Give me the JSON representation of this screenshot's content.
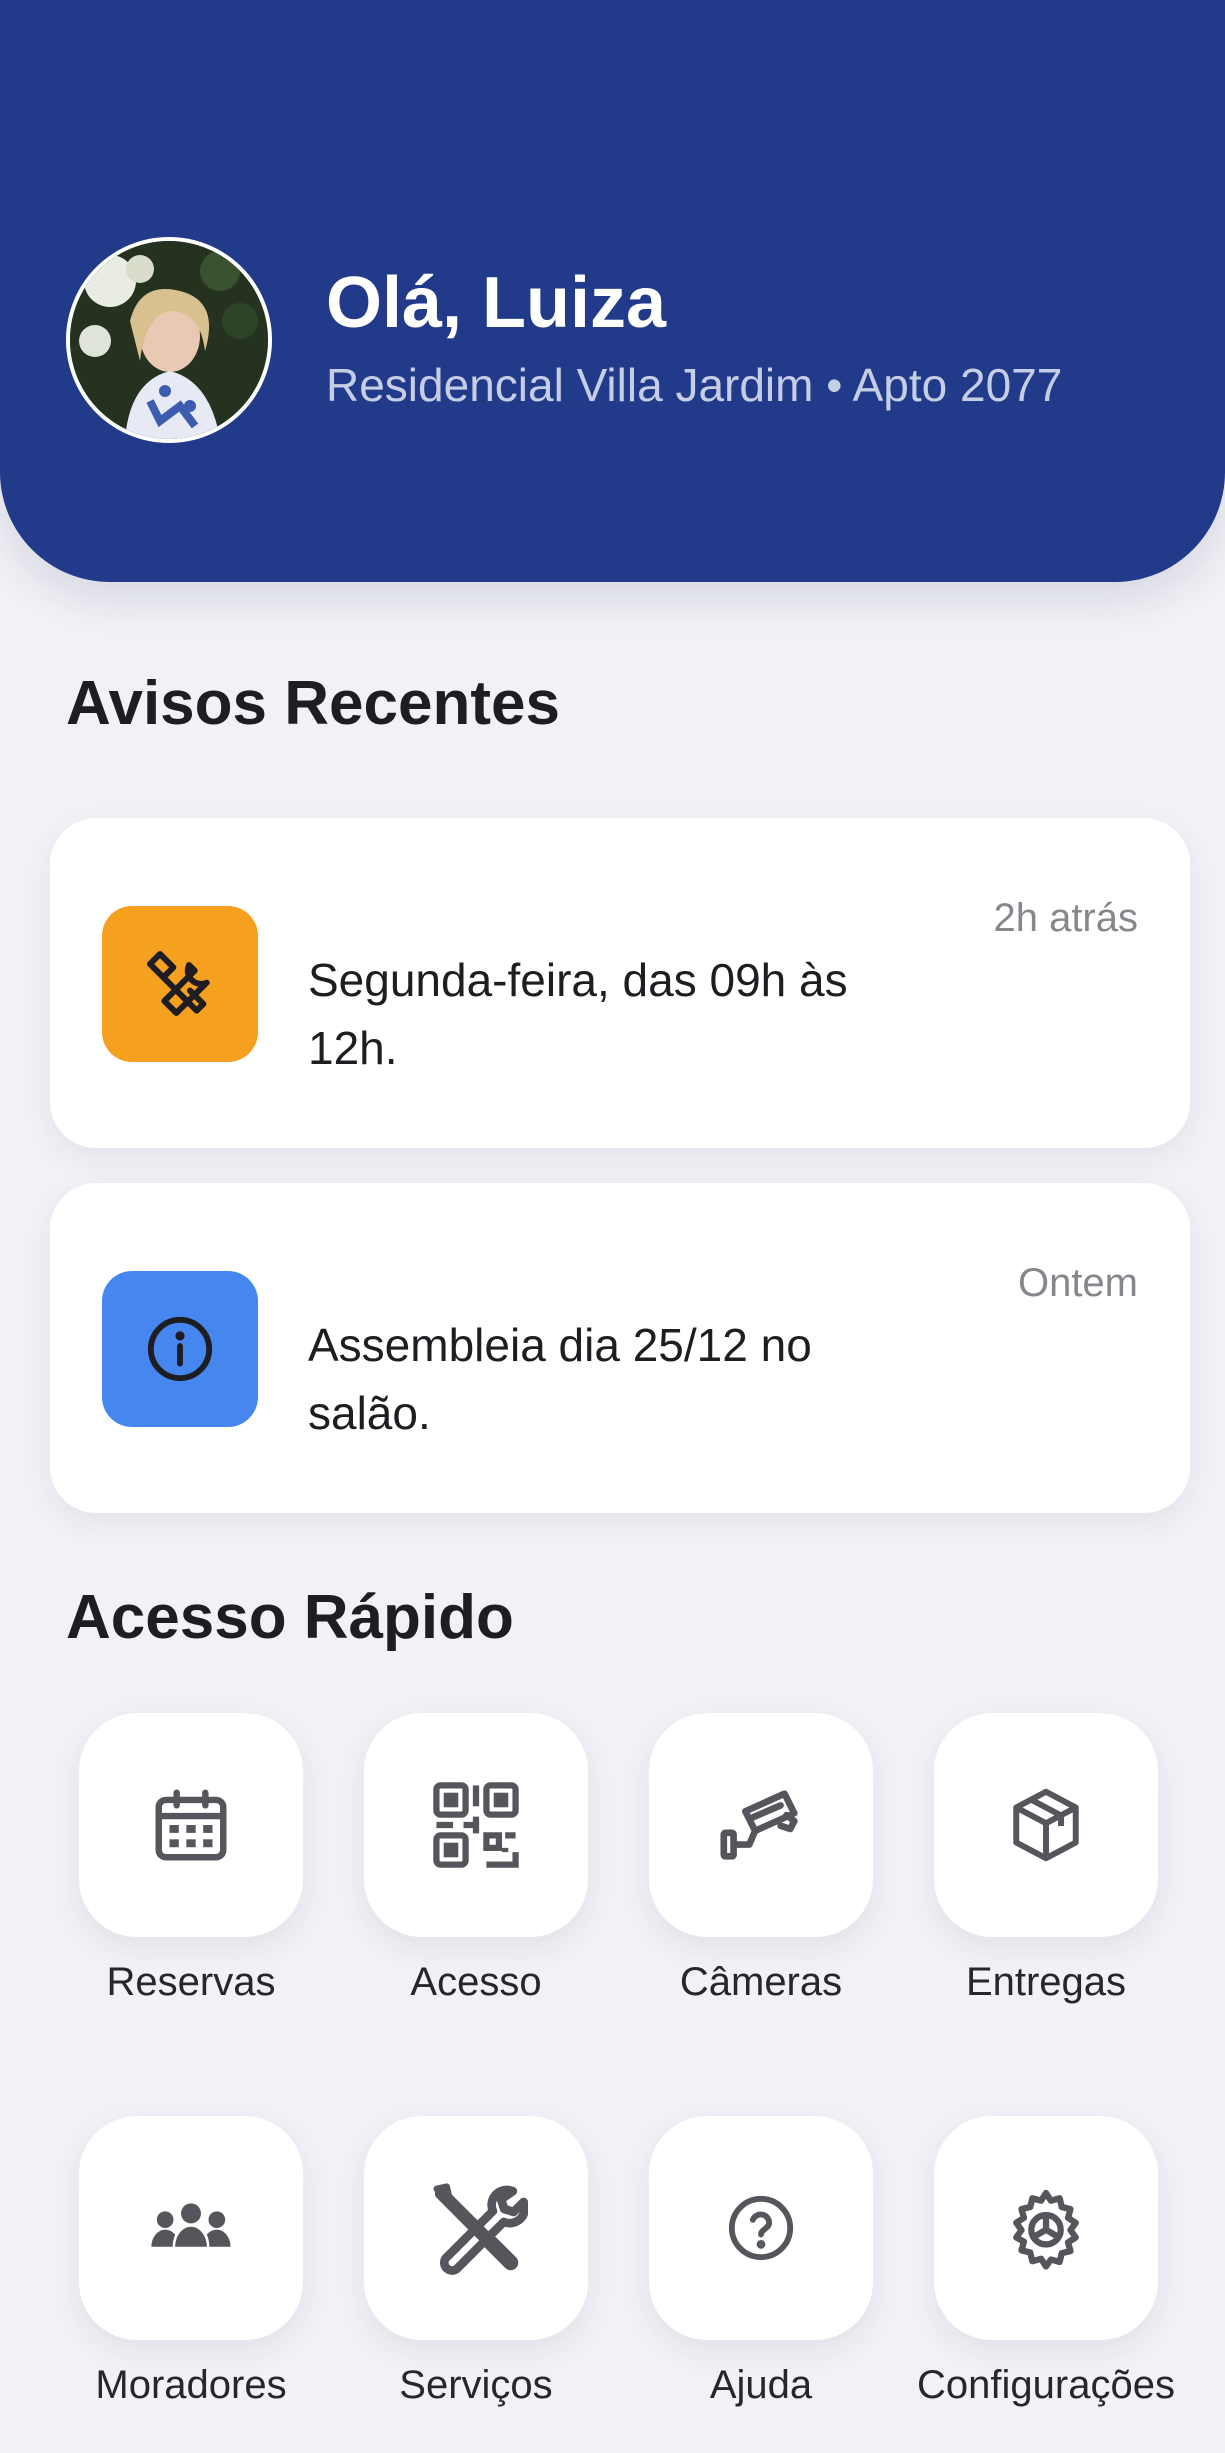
{
  "header": {
    "greeting": "Olá, Luiza",
    "subtitle": "Residencial Villa Jardim • Apto 2077",
    "avatar_icon": "user-avatar-photo",
    "background_color": "#223a8a"
  },
  "notices": {
    "title": "Avisos Recentes",
    "items": [
      {
        "icon": "maintenance-tools-icon",
        "icon_bg": "#f5a01e",
        "time": "2h atrás",
        "text": "Segunda-feira, das 09h às 12h."
      },
      {
        "icon": "info-icon",
        "icon_bg": "#4587ee",
        "time": "Ontem",
        "text": "Assembleia dia 25/12 no salão."
      }
    ]
  },
  "quick_access": {
    "title": "Acesso Rápido",
    "items": [
      {
        "label": "Reservas",
        "icon": "calendar-icon"
      },
      {
        "label": "Acesso",
        "icon": "qr-code-icon"
      },
      {
        "label": "Câmeras",
        "icon": "security-camera-icon"
      },
      {
        "label": "Entregas",
        "icon": "package-icon"
      },
      {
        "label": "Moradores",
        "icon": "residents-icon"
      },
      {
        "label": "Serviços",
        "icon": "tools-icon"
      },
      {
        "label": "Ajuda",
        "icon": "help-icon"
      },
      {
        "label": "Configurações",
        "icon": "gear-icon"
      }
    ]
  }
}
